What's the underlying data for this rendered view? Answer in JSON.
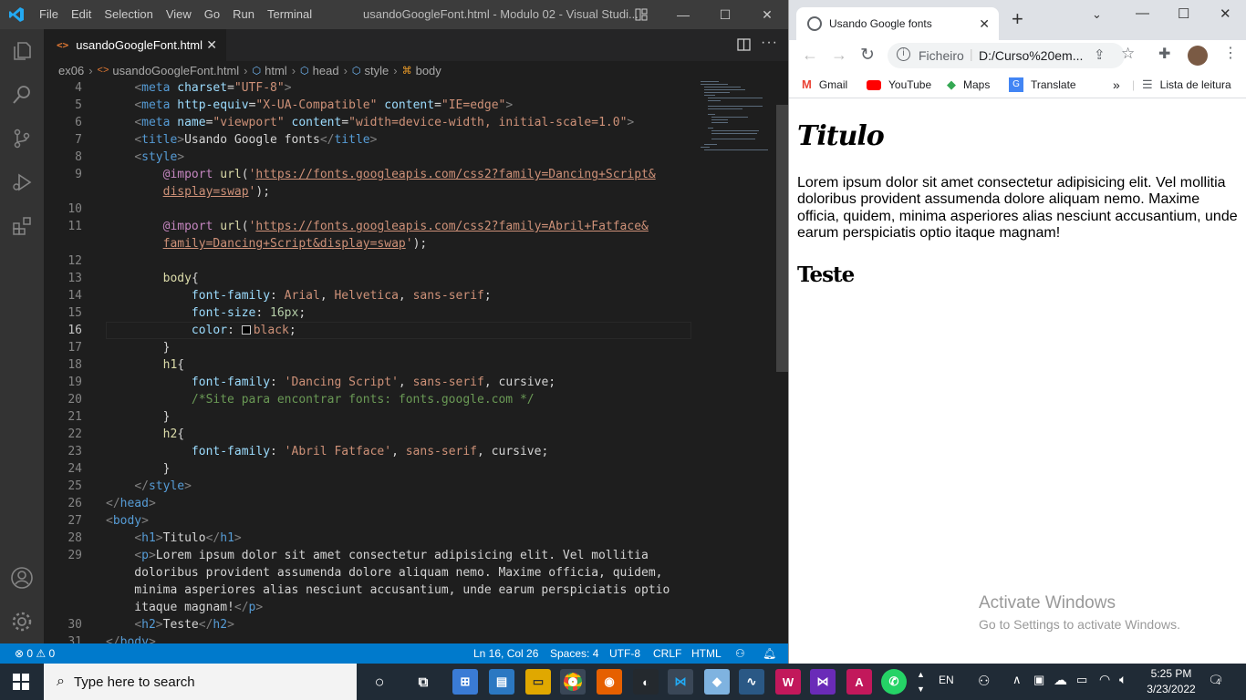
{
  "vscode": {
    "menu": [
      "File",
      "Edit",
      "Selection",
      "View",
      "Go",
      "Run",
      "Terminal"
    ],
    "window_title": "usandoGoogleFont.html - Modulo 02 - Visual Studi...",
    "tab_label": "usandoGoogleFont.html",
    "breadcrumb": [
      "ex06",
      "usandoGoogleFont.html",
      "html",
      "head",
      "style",
      "body"
    ],
    "code_lines": [
      {
        "n": "4",
        "html": "    <span class='gr'>&lt;</span><span class='tg'>meta</span> <span class='at'>charset</span>=<span class='st'>\"UTF-8\"</span><span class='gr'>&gt;</span>"
      },
      {
        "n": "5",
        "html": "    <span class='gr'>&lt;</span><span class='tg'>meta</span> <span class='at'>http-equiv</span>=<span class='st'>\"X-UA-Compatible\"</span> <span class='at'>content</span>=<span class='st'>\"IE=edge\"</span><span class='gr'>&gt;</span>"
      },
      {
        "n": "6",
        "html": "    <span class='gr'>&lt;</span><span class='tg'>meta</span> <span class='at'>name</span>=<span class='st'>\"viewport\"</span> <span class='at'>content</span>=<span class='st'>\"width=device-width, initial-scale=1.0\"</span><span class='gr'>&gt;</span>"
      },
      {
        "n": "7",
        "html": "    <span class='gr'>&lt;</span><span class='tg'>title</span><span class='gr'>&gt;</span>Usando Google fonts<span class='gr'>&lt;/</span><span class='tg'>title</span><span class='gr'>&gt;</span>"
      },
      {
        "n": "8",
        "html": "    <span class='gr'>&lt;</span><span class='tg'>style</span><span class='gr'>&gt;</span>"
      },
      {
        "n": "9",
        "html": "        <span class='kw'>@import</span> <span class='ff'>url</span>(<span class='st'>'<span class='ul'>https://fonts.googleapis.com/css2?family=Dancing+Script&amp;</span></span>"
      },
      {
        "n": "",
        "html": "        <span class='st'><span class='ul'>display=swap</span>'</span>);"
      },
      {
        "n": "10",
        "html": ""
      },
      {
        "n": "11",
        "html": "        <span class='kw'>@import</span> <span class='ff'>url</span>(<span class='st'>'<span class='ul'>https://fonts.googleapis.com/css2?family=Abril+Fatface&amp;</span></span>"
      },
      {
        "n": "",
        "html": "        <span class='st'><span class='ul'>family=Dancing+Script&amp;display=swap</span>'</span>);"
      },
      {
        "n": "12",
        "html": ""
      },
      {
        "n": "13",
        "html": "        <span class='ff'>body</span>{"
      },
      {
        "n": "14",
        "html": "            <span class='pr'>font-family</span>: <span class='vl'>Arial</span>, <span class='vl'>Helvetica</span>, <span class='vl'>sans-serif</span>;"
      },
      {
        "n": "15",
        "html": "            <span class='pr'>font-size</span>: <span class='nm'>16px</span>;"
      },
      {
        "n": "16",
        "html": "            <span class='pr'>color</span>: <span style='display:inline-block;width:10px;height:10px;border:1px solid #ccc;background:#000;vertical-align:-1px;margin-right:3px'></span><span class='vl'>black</span>;"
      },
      {
        "n": "17",
        "html": "        }"
      },
      {
        "n": "18",
        "html": "        <span class='ff'>h1</span>{"
      },
      {
        "n": "19",
        "html": "            <span class='pr'>font-family</span>: <span class='st'>'Dancing Script'</span>, <span class='vl'>sans-serif</span>, cursive;"
      },
      {
        "n": "20",
        "html": "            <span class='cm'>/*Site para encontrar fonts: fonts.google.com */</span>"
      },
      {
        "n": "21",
        "html": "        }"
      },
      {
        "n": "22",
        "html": "        <span class='ff'>h2</span>{"
      },
      {
        "n": "23",
        "html": "            <span class='pr'>font-family</span>: <span class='st'>'Abril Fatface'</span>, <span class='vl'>sans-serif</span>, cursive;"
      },
      {
        "n": "24",
        "html": "        }"
      },
      {
        "n": "25",
        "html": "    <span class='gr'>&lt;/</span><span class='tg'>style</span><span class='gr'>&gt;</span>"
      },
      {
        "n": "26",
        "html": "<span class='gr'>&lt;/</span><span class='tg'>head</span><span class='gr'>&gt;</span>"
      },
      {
        "n": "27",
        "html": "<span class='gr'>&lt;</span><span class='tg'>body</span><span class='gr'>&gt;</span>"
      },
      {
        "n": "28",
        "html": "    <span class='gr'>&lt;</span><span class='tg'>h1</span><span class='gr'>&gt;</span>Titulo<span class='gr'>&lt;/</span><span class='tg'>h1</span><span class='gr'>&gt;</span>"
      },
      {
        "n": "29",
        "html": "    <span class='gr'>&lt;</span><span class='tg'>p</span><span class='gr'>&gt;</span>Lorem ipsum dolor sit amet consectetur adipisicing elit. Vel mollitia"
      },
      {
        "n": "",
        "html": "    doloribus provident assumenda dolore aliquam nemo. Maxime officia, quidem,"
      },
      {
        "n": "",
        "html": "    minima asperiores alias nesciunt accusantium, unde earum perspiciatis optio"
      },
      {
        "n": "",
        "html": "    itaque magnam!<span class='gr'>&lt;/</span><span class='tg'>p</span><span class='gr'>&gt;</span>"
      },
      {
        "n": "30",
        "html": "    <span class='gr'>&lt;</span><span class='tg'>h2</span><span class='gr'>&gt;</span>Teste<span class='gr'>&lt;/</span><span class='tg'>h2</span><span class='gr'>&gt;</span>"
      },
      {
        "n": "31",
        "html": "<span class='gr'>&lt;/</span><span class='tg'>body</span><span class='gr'>&gt;</span>"
      }
    ],
    "status": {
      "problems": "⊗ 0 ⚠ 0",
      "position": "Ln 16, Col 26",
      "spaces": "Spaces: 4",
      "encoding": "UTF-8",
      "eol": "CRLF",
      "language": "HTML"
    }
  },
  "browser": {
    "tab_title": "Usando Google fonts",
    "url_prefix": "Ficheiro",
    "url": "D:/Curso%20em...",
    "bookmarks": [
      "Gmail",
      "YouTube",
      "Maps",
      "Translate"
    ],
    "reading_list": "Lista de leitura",
    "page": {
      "h1": "Titulo",
      "p": "Lorem ipsum dolor sit amet consectetur adipisicing elit. Vel mollitia doloribus provident assumenda dolore aliquam nemo. Maxime officia, quidem, minima asperiores alias nesciunt accusantium, unde earum perspiciatis optio itaque magnam!",
      "h2": "Teste"
    },
    "watermark": {
      "line1": "Activate Windows",
      "line2": "Go to Settings to activate Windows."
    }
  },
  "taskbar": {
    "search_placeholder": "Type here to search",
    "lang": "EN",
    "time": "5:25 PM",
    "date": "3/23/2022",
    "notifications": "4"
  },
  "colors": {
    "accent": "#007acc",
    "titlebar": "#3c3c3c",
    "activitybar": "#333333"
  }
}
